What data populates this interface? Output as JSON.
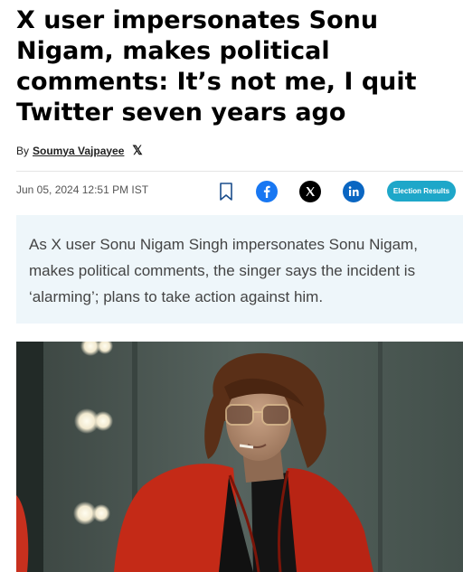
{
  "article": {
    "headline": "X user impersonates Sonu Nigam, makes political comments: It’s not me, I quit Twitter seven years ago",
    "byline_prefix": "By",
    "author": "Soumya Vajpayee",
    "published": "Jun 05, 2024 12:51 PM IST",
    "summary": "As X user Sonu Nigam Singh impersonates Sonu Nigam, makes political comments, the singer says the incident is ‘alarming’; plans to take action against him."
  },
  "share": {
    "icons": [
      "bookmark-icon",
      "facebook-icon",
      "x-icon",
      "linkedin-icon"
    ],
    "election_button_label": "Election Results"
  },
  "colors": {
    "facebook": "#1877f2",
    "x": "#000000",
    "linkedin": "#0a66c2",
    "election_button": "#1ea7c9",
    "summary_bg": "#eef6fa"
  }
}
